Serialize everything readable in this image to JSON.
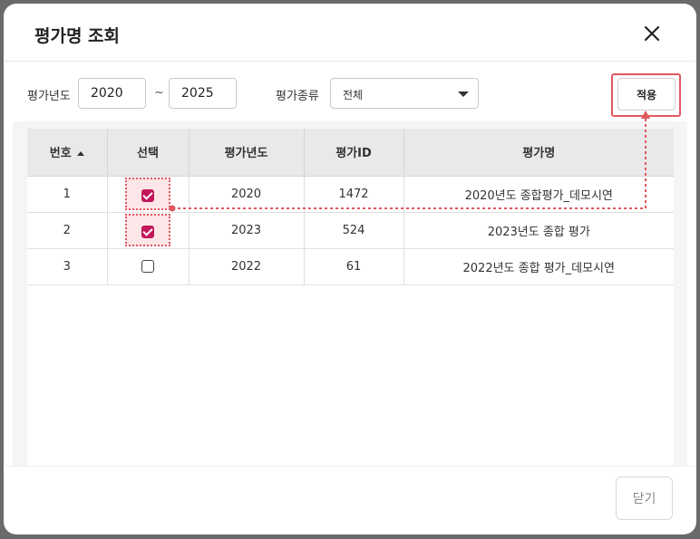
{
  "dialog": {
    "title": "평가명 조회"
  },
  "filters": {
    "year_label": "평가년도",
    "year_from": "2020",
    "range_separator": "~",
    "year_to": "2025",
    "type_label": "평가종류",
    "type_selected": "전체",
    "apply_label": "적용"
  },
  "table": {
    "columns": [
      "번호",
      "선택",
      "평가년도",
      "평가ID",
      "평가명"
    ],
    "sort_column": "번호",
    "sort_direction": "ascending",
    "rows": [
      {
        "no": "1",
        "selected": true,
        "year": "2020",
        "id": "1472",
        "name": "2020년도 종합평가_데모시연"
      },
      {
        "no": "2",
        "selected": true,
        "year": "2023",
        "id": "524",
        "name": "2023년도 종합 평가"
      },
      {
        "no": "3",
        "selected": false,
        "year": "2022",
        "id": "61",
        "name": "2022년도 종합 평가_데모시연"
      }
    ]
  },
  "footer": {
    "close_label": "닫기"
  },
  "colors": {
    "accent": "#c2185b",
    "highlight": "#e0585f"
  }
}
